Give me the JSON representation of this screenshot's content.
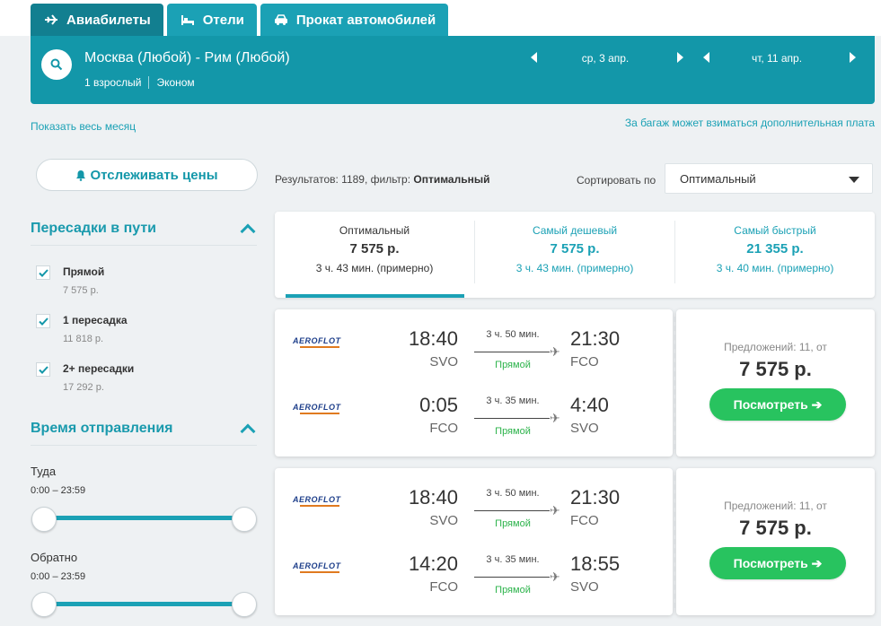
{
  "tabs": [
    {
      "label": "Авиабилеты",
      "icon": "plane-icon"
    },
    {
      "label": "Отели",
      "icon": "bed-icon"
    },
    {
      "label": "Прокат автомобилей",
      "icon": "car-icon"
    }
  ],
  "search": {
    "route": "Москва (Любой) - Рим (Любой)",
    "passengers": "1 взрослый",
    "cabin": "Эконом",
    "depart_date": "ср, 3 апр.",
    "return_date": "чт, 11 апр."
  },
  "links": {
    "show_month": "Показать весь месяц",
    "baggage_note": "За багаж может взиматься дополнительная плата"
  },
  "track_prices": "Отслеживать цены",
  "filters": {
    "stops_title": "Пересадки в пути",
    "stops": [
      {
        "label": "Прямой",
        "price": "7 575 р.",
        "checked": true
      },
      {
        "label": "1 пересадка",
        "price": "11 818 р.",
        "checked": true
      },
      {
        "label": "2+ пересадки",
        "price": "17 292 р.",
        "checked": true
      }
    ],
    "departure_title": "Время отправления",
    "outbound_label": "Туда",
    "outbound_range": "0:00 – 23:59",
    "return_label": "Обратно",
    "return_range": "0:00 – 23:59"
  },
  "results": {
    "count_prefix": "Результатов: 1189, фильтр: ",
    "filter_name": "Оптимальный",
    "sort_label": "Сортировать по",
    "sort_value": "Оптимальный"
  },
  "sort_tabs": [
    {
      "title": "Оптимальный",
      "price": "7 575 р.",
      "duration": "3 ч. 43 мин. (примерно)",
      "active": true
    },
    {
      "title": "Самый дешевый",
      "price": "7 575 р.",
      "duration": "3 ч. 43 мин. (примерно)",
      "active": false
    },
    {
      "title": "Самый быстрый",
      "price": "21 355 р.",
      "duration": "3 ч. 40 мин. (примерно)",
      "active": false
    }
  ],
  "offers": [
    {
      "legs": [
        {
          "airline": "AEROFLOT",
          "dep_time": "18:40",
          "dep_code": "SVO",
          "duration": "3 ч. 50 мин.",
          "stops": "Прямой",
          "arr_time": "21:30",
          "arr_code": "FCO"
        },
        {
          "airline": "AEROFLOT",
          "dep_time": "0:05",
          "dep_code": "FCO",
          "duration": "3 ч. 35 мин.",
          "stops": "Прямой",
          "arr_time": "4:40",
          "arr_code": "SVO"
        }
      ],
      "offers_count": "Предложений: 11, от",
      "price": "7 575 р.",
      "button": "Посмотреть ➔"
    },
    {
      "legs": [
        {
          "airline": "AEROFLOT",
          "dep_time": "18:40",
          "dep_code": "SVO",
          "duration": "3 ч. 50 мин.",
          "stops": "Прямой",
          "arr_time": "21:30",
          "arr_code": "FCO"
        },
        {
          "airline": "AEROFLOT",
          "dep_time": "14:20",
          "dep_code": "FCO",
          "duration": "3 ч. 35 мин.",
          "stops": "Прямой",
          "arr_time": "18:55",
          "arr_code": "SVO"
        }
      ],
      "offers_count": "Предложений: 11, от",
      "price": "7 575 р.",
      "button": "Посмотреть ➔"
    }
  ],
  "colors": {
    "accent": "#1ba1b5",
    "header": "#1397a9",
    "cta": "#28c35f"
  }
}
